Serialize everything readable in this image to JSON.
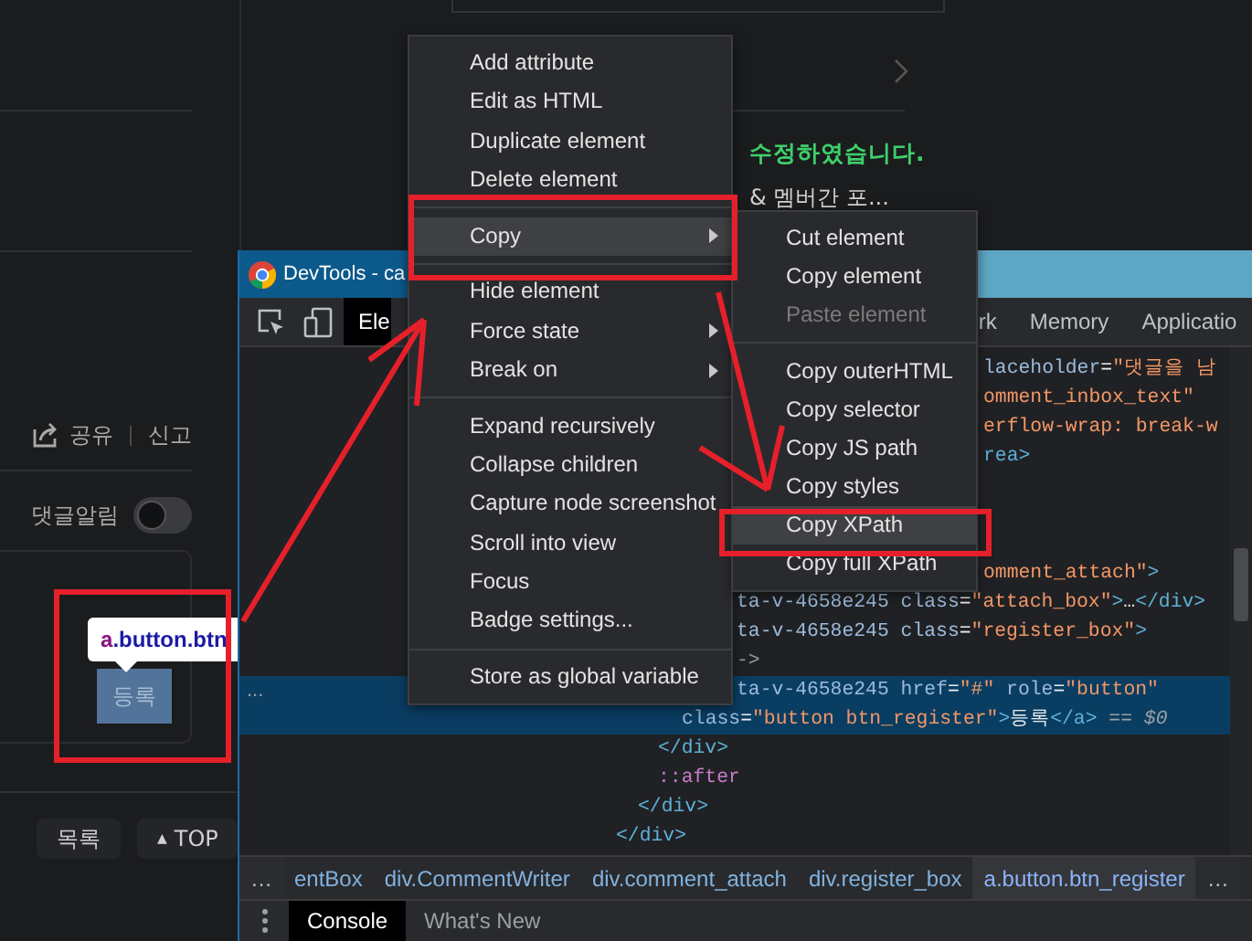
{
  "page": {
    "share_label": "공유",
    "report_label": "신고",
    "comment_alert": {
      "label": "댓글알림",
      "on": false
    },
    "tooltip": {
      "tag": "a",
      "classes": ".button.btn"
    },
    "register_button": "등록",
    "list_button": "목록",
    "top_button": {
      "icon": "▲",
      "label": "TOP"
    },
    "notice": {
      "highlight": "수정하였습니다.",
      "text": "& 멤버간 포..."
    }
  },
  "devtools": {
    "title": "DevTools - ca",
    "tabs": [
      {
        "label": "Ele",
        "selected": true
      },
      {
        "label": "rk",
        "selected": false
      },
      {
        "label": "Memory",
        "selected": false
      },
      {
        "label": "Applicatio",
        "selected": false
      }
    ],
    "code_lines": [
      {
        "selected": false,
        "tokens": [
          {
            "kind": "attr",
            "text": "laceholder"
          },
          {
            "kind": "punct",
            "text": "="
          },
          {
            "kind": "value",
            "text": "\"댓글을 남"
          }
        ]
      },
      {
        "selected": false,
        "tokens": [
          {
            "kind": "value",
            "text": "omment_inbox_text\""
          }
        ]
      },
      {
        "selected": false,
        "tokens": [
          {
            "kind": "value",
            "text": "erflow-wrap: break-w"
          }
        ]
      },
      {
        "selected": false,
        "tokens": [
          {
            "kind": "tag",
            "text": "rea>"
          }
        ]
      },
      {
        "selected": false,
        "tokens": [
          {
            "kind": "value",
            "text": "omment_attach\""
          },
          {
            "kind": "tag",
            "text": ">"
          }
        ]
      },
      {
        "selected": false,
        "tokens": [
          {
            "kind": "attr",
            "text": "ta-v-4658e245 class"
          },
          {
            "kind": "punct",
            "text": "="
          },
          {
            "kind": "value",
            "text": "\"attach_box\""
          },
          {
            "kind": "tag",
            "text": ">"
          },
          {
            "kind": "punct",
            "text": "…"
          },
          {
            "kind": "tag",
            "text": "</div>"
          }
        ]
      },
      {
        "selected": false,
        "tokens": [
          {
            "kind": "attr",
            "text": "ta-v-4658e245 class"
          },
          {
            "kind": "punct",
            "text": "="
          },
          {
            "kind": "value",
            "text": "\"register_box\""
          },
          {
            "kind": "tag",
            "text": ">"
          }
        ]
      },
      {
        "selected": false,
        "tokens": [
          {
            "kind": "comment",
            "text": "->"
          }
        ]
      },
      {
        "selected": true,
        "gutter": "...",
        "tokens": [
          {
            "kind": "attr",
            "text": "ta-v-4658e245 href"
          },
          {
            "kind": "punct",
            "text": "="
          },
          {
            "kind": "value",
            "text": "\"#\""
          },
          {
            "kind": "attr",
            "text": " role"
          },
          {
            "kind": "punct",
            "text": "="
          },
          {
            "kind": "value",
            "text": "\"button\""
          }
        ]
      },
      {
        "selected": true,
        "tokens": [
          {
            "kind": "attr",
            "text": "class"
          },
          {
            "kind": "punct",
            "text": "="
          },
          {
            "kind": "value",
            "text": "\"button btn_register\""
          },
          {
            "kind": "tag",
            "text": ">"
          },
          {
            "kind": "punct",
            "text": "등록"
          },
          {
            "kind": "tag",
            "text": "</a>"
          },
          {
            "kind": "dollar",
            "text": " == $0"
          }
        ]
      },
      {
        "selected": false,
        "tokens": [
          {
            "kind": "tag",
            "text": "</div>"
          }
        ]
      },
      {
        "selected": false,
        "tokens": [
          {
            "kind": "pseudo",
            "text": "::after"
          }
        ]
      },
      {
        "selected": false,
        "tokens": [
          {
            "kind": "tag",
            "text": "</div>"
          }
        ]
      },
      {
        "selected": false,
        "tokens": [
          {
            "kind": "tag",
            "text": "</div>"
          }
        ]
      }
    ],
    "breadcrumbs": [
      {
        "kind": "overflow",
        "label": "…",
        "selected": false
      },
      {
        "kind": "crumb",
        "label": "entBox",
        "selected": false
      },
      {
        "kind": "crumb",
        "label": "div.CommentWriter",
        "selected": false
      },
      {
        "kind": "crumb",
        "label": "div.comment_attach",
        "selected": false
      },
      {
        "kind": "crumb",
        "label": "div.register_box",
        "selected": false
      },
      {
        "kind": "crumb",
        "label": "a.button.btn_register",
        "selected": true
      },
      {
        "kind": "overflow",
        "label": "…",
        "selected": false
      }
    ],
    "drawer_tabs": [
      {
        "label": "Console",
        "selected": true
      },
      {
        "label": "What's New",
        "selected": false
      }
    ]
  },
  "context_menu": {
    "items": [
      {
        "kind": "item",
        "label": "Add attribute",
        "selected": false,
        "disabled": false,
        "has_submenu": false
      },
      {
        "kind": "item",
        "label": "Edit as HTML",
        "selected": false,
        "disabled": false,
        "has_submenu": false
      },
      {
        "kind": "item",
        "label": "Duplicate element",
        "selected": false,
        "disabled": false,
        "has_submenu": false
      },
      {
        "kind": "item",
        "label": "Delete element",
        "selected": false,
        "disabled": false,
        "has_submenu": false
      },
      {
        "kind": "separator"
      },
      {
        "kind": "item",
        "label": "Copy",
        "selected": true,
        "disabled": false,
        "has_submenu": true
      },
      {
        "kind": "separator"
      },
      {
        "kind": "item",
        "label": "Hide element",
        "selected": false,
        "disabled": false,
        "has_submenu": false
      },
      {
        "kind": "item",
        "label": "Force state",
        "selected": false,
        "disabled": false,
        "has_submenu": true
      },
      {
        "kind": "item",
        "label": "Break on",
        "selected": false,
        "disabled": false,
        "has_submenu": true
      },
      {
        "kind": "separator"
      },
      {
        "kind": "item",
        "label": "Expand recursively",
        "selected": false,
        "disabled": false,
        "has_submenu": false
      },
      {
        "kind": "item",
        "label": "Collapse children",
        "selected": false,
        "disabled": false,
        "has_submenu": false
      },
      {
        "kind": "item",
        "label": "Capture node screenshot",
        "selected": false,
        "disabled": false,
        "has_submenu": false
      },
      {
        "kind": "item",
        "label": "Scroll into view",
        "selected": false,
        "disabled": false,
        "has_submenu": false
      },
      {
        "kind": "item",
        "label": "Focus",
        "selected": false,
        "disabled": false,
        "has_submenu": false
      },
      {
        "kind": "item",
        "label": "Badge settings...",
        "selected": false,
        "disabled": false,
        "has_submenu": false
      },
      {
        "kind": "separator"
      },
      {
        "kind": "item",
        "label": "Store as global variable",
        "selected": false,
        "disabled": false,
        "has_submenu": false
      }
    ]
  },
  "submenu": {
    "items": [
      {
        "kind": "item",
        "label": "Cut element",
        "selected": false,
        "disabled": false,
        "has_submenu": false
      },
      {
        "kind": "item",
        "label": "Copy element",
        "selected": false,
        "disabled": false,
        "has_submenu": false
      },
      {
        "kind": "item",
        "label": "Paste element",
        "selected": false,
        "disabled": true,
        "has_submenu": false
      },
      {
        "kind": "separator"
      },
      {
        "kind": "item",
        "label": "Copy outerHTML",
        "selected": false,
        "disabled": false,
        "has_submenu": false
      },
      {
        "kind": "item",
        "label": "Copy selector",
        "selected": false,
        "disabled": false,
        "has_submenu": false
      },
      {
        "kind": "item",
        "label": "Copy JS path",
        "selected": false,
        "disabled": false,
        "has_submenu": false
      },
      {
        "kind": "item",
        "label": "Copy styles",
        "selected": false,
        "disabled": false,
        "has_submenu": false
      },
      {
        "kind": "item",
        "label": "Copy XPath",
        "selected": true,
        "disabled": false,
        "has_submenu": false
      },
      {
        "kind": "item",
        "label": "Copy full XPath",
        "selected": false,
        "disabled": false,
        "has_submenu": false
      }
    ]
  }
}
